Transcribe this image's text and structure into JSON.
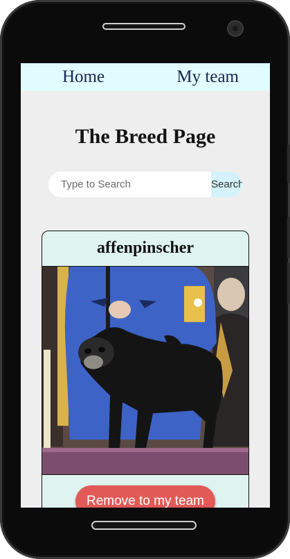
{
  "nav": {
    "home": "Home",
    "my_team": "My team"
  },
  "page_title": "The Breed Page",
  "search": {
    "placeholder": "Type to Search",
    "button_label": "Search"
  },
  "card": {
    "breed": "affenpinscher",
    "action_label": "Remove to my team",
    "image": "affenpinscher-dog-photo"
  },
  "colors": {
    "nav_bg": "#e0fcfe",
    "screen_bg": "#eeeeee",
    "card_bg": "#dff4f1",
    "search_button_bg": "#d4f2fb",
    "remove_button": "#e25a57"
  }
}
